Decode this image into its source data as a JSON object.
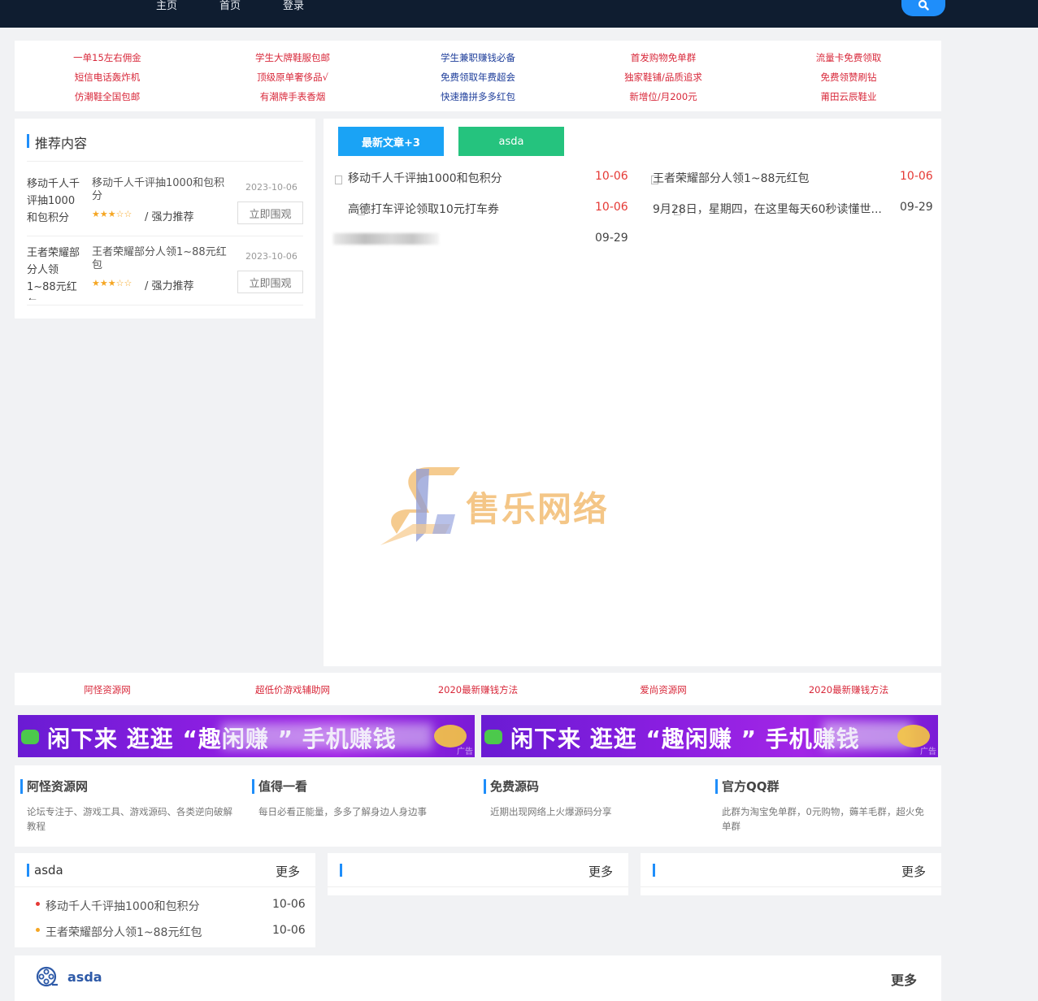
{
  "nav": {
    "items": [
      "主页",
      "首页",
      "登录"
    ],
    "search_icon": "search-icon"
  },
  "links": [
    [
      {
        "text": "一单15左右佣金",
        "color": "#d8283a"
      },
      {
        "text": "学生大牌鞋服包邮",
        "color": "#d8283a"
      },
      {
        "text": "学生兼职赚钱必备",
        "color": "#1d3d9a"
      },
      {
        "text": "首发购物免单群",
        "color": "#d8283a"
      },
      {
        "text": "流量卡免费领取",
        "color": "#d8283a"
      }
    ],
    [
      {
        "text": "短信电话轰炸机",
        "color": "#d8283a"
      },
      {
        "text": "顶级原单奢侈品√",
        "color": "#d8283a"
      },
      {
        "text": "免费领取年费超会",
        "color": "#1d3d9a"
      },
      {
        "text": "独家鞋铺/品质追求",
        "color": "#d8283a"
      },
      {
        "text": "免费领赞刷钻",
        "color": "#d8283a"
      }
    ],
    [
      {
        "text": "仿潮鞋全国包邮",
        "color": "#d8283a"
      },
      {
        "text": "有潮牌手表香烟",
        "color": "#d8283a"
      },
      {
        "text": "快速撸拼多多红包",
        "color": "#1d3d9a"
      },
      {
        "text": "新增位/月200元",
        "color": "#d8283a"
      },
      {
        "text": "莆田云辰鞋业",
        "color": "#d8283a"
      }
    ]
  ],
  "recommend": {
    "title": "推荐内容",
    "items": [
      {
        "thumb_alt": "移动千人千评抽1000和包积分",
        "title": "移动千人千评抽1000和包积分",
        "date": "2023-10-06",
        "stars": "★★★☆☆",
        "tag": "/ 强力推荐",
        "button": "立即围观"
      },
      {
        "thumb_alt": "王者荣耀部分人领1~88元红包",
        "title": "王者荣耀部分人领1~88元红包",
        "date": "2023-10-06",
        "stars": "★★★☆☆",
        "tag": "/ 强力推荐",
        "button": "立即围观"
      }
    ]
  },
  "tabs": [
    {
      "label": "最新文章+3",
      "color": "#1aa3f5"
    },
    {
      "label": "asda",
      "color": "#25c37e"
    }
  ],
  "articles": [
    {
      "title": "移动千人千评抽1000和包积分",
      "date": "10-06",
      "date_color": "#e53935"
    },
    {
      "title": "王者荣耀部分人领1~88元红包",
      "date": "10-06",
      "date_color": "#e53935"
    },
    {
      "title": "高德打车评论领取10元打车券",
      "date": "10-06",
      "date_color": "#e53935"
    },
    {
      "title": "9月28日，星期四，在这里每天60秒读懂世...",
      "date": "09-29",
      "date_color": "#444444"
    },
    {
      "title": "",
      "date": "09-29",
      "date_color": "#444444"
    }
  ],
  "watermark": {
    "text": "售乐网络"
  },
  "friend_links": [
    "阿怪资源网",
    "超低价游戏辅助网",
    "2020最新赚钱方法",
    "爱尚资源网",
    "2020最新赚钱方法"
  ],
  "banners": [
    {
      "text": "闲下来 逛逛 “趣闲赚 ” 手机赚钱",
      "ad": "广告"
    },
    {
      "text": "闲下来 逛逛 “趣闲赚 ” 手机赚钱",
      "ad": "广告"
    }
  ],
  "info_blocks": [
    {
      "title": "阿怪资源网",
      "desc": "论坛专注于、游戏工具、游戏源码、各类逆向破解教程"
    },
    {
      "title": "值得一看",
      "desc": "每日必看正能量，多多了解身边人身边事"
    },
    {
      "title": "免费源码",
      "desc": "近期出现网络上火爆源码分享"
    },
    {
      "title": "官方QQ群",
      "desc": "此群为淘宝免单群，0元购物，薅羊毛群，超火免单群"
    }
  ],
  "boxes": [
    {
      "title": "asda",
      "more": "更多",
      "items": [
        {
          "title": "移动千人千评抽1000和包积分",
          "date": "10-06",
          "dot": "#e53935"
        },
        {
          "title": "王者荣耀部分人领1~88元红包",
          "date": "10-06",
          "dot": "#f5a623"
        }
      ]
    },
    {
      "title": "",
      "more": "更多",
      "items": []
    },
    {
      "title": "",
      "more": "更多",
      "items": []
    }
  ],
  "bottom": {
    "title": "asda",
    "more": "更多",
    "icon": "film-reel-icon"
  }
}
